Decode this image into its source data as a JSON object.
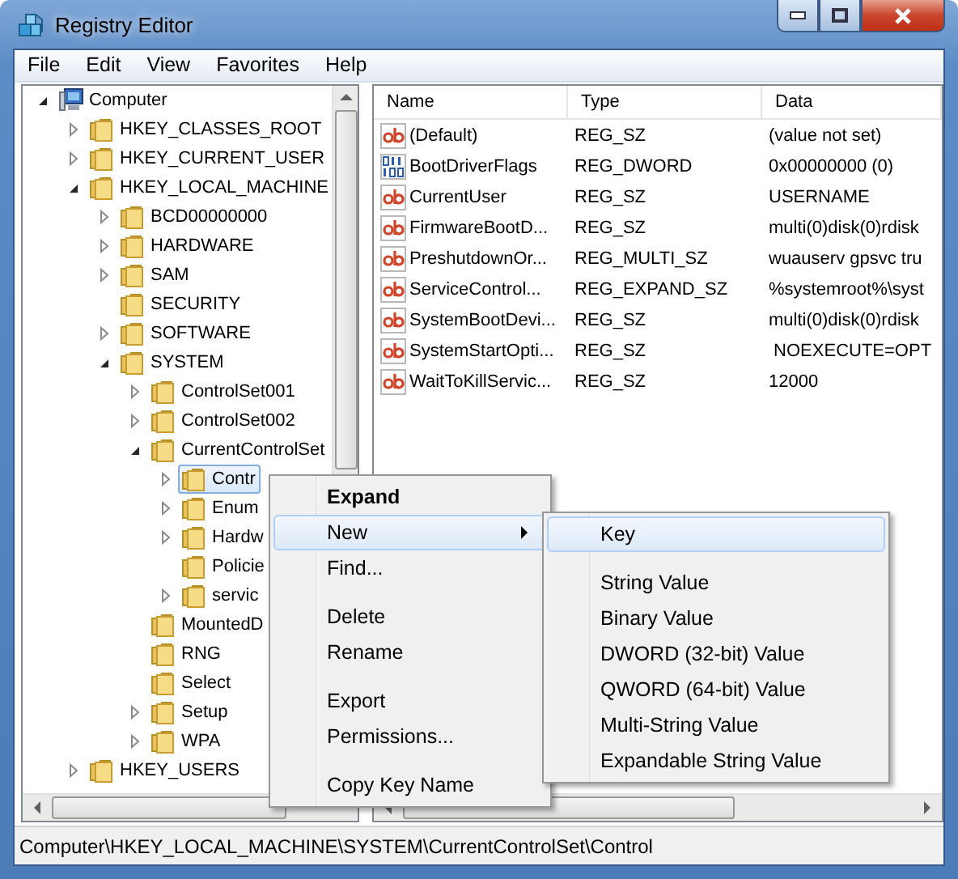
{
  "window": {
    "title": "Registry Editor"
  },
  "menu_bar": [
    "File",
    "Edit",
    "View",
    "Favorites",
    "Help"
  ],
  "tree": [
    {
      "label": "Computer",
      "kind": "computer",
      "expander": true,
      "expanded": true,
      "selected": false,
      "children": [
        {
          "label": "HKEY_CLASSES_ROOT",
          "kind": "folder",
          "expander": true,
          "expanded": false,
          "selected": false
        },
        {
          "label": "HKEY_CURRENT_USER",
          "kind": "folder",
          "expander": true,
          "expanded": false,
          "selected": false
        },
        {
          "label": "HKEY_LOCAL_MACHINE",
          "kind": "folder",
          "expander": true,
          "expanded": true,
          "selected": false,
          "children": [
            {
              "label": "BCD00000000",
              "kind": "folder",
              "expander": true,
              "expanded": false,
              "selected": false
            },
            {
              "label": "HARDWARE",
              "kind": "folder",
              "expander": true,
              "expanded": false,
              "selected": false
            },
            {
              "label": "SAM",
              "kind": "folder",
              "expander": true,
              "expanded": false,
              "selected": false
            },
            {
              "label": "SECURITY",
              "kind": "folder",
              "expander": false,
              "expanded": false,
              "selected": false
            },
            {
              "label": "SOFTWARE",
              "kind": "folder",
              "expander": true,
              "expanded": false,
              "selected": false
            },
            {
              "label": "SYSTEM",
              "kind": "folder",
              "expander": true,
              "expanded": true,
              "selected": false,
              "children": [
                {
                  "label": "ControlSet001",
                  "kind": "folder",
                  "expander": true,
                  "expanded": false,
                  "selected": false
                },
                {
                  "label": "ControlSet002",
                  "kind": "folder",
                  "expander": true,
                  "expanded": false,
                  "selected": false
                },
                {
                  "label": "CurrentControlSet",
                  "kind": "folder",
                  "expander": true,
                  "expanded": true,
                  "selected": false,
                  "children": [
                    {
                      "label": "Contr",
                      "kind": "folder",
                      "expander": true,
                      "expanded": false,
                      "selected": true
                    },
                    {
                      "label": "Enum",
                      "kind": "folder",
                      "expander": true,
                      "expanded": false,
                      "selected": false
                    },
                    {
                      "label": "Hardw",
                      "kind": "folder",
                      "expander": true,
                      "expanded": false,
                      "selected": false
                    },
                    {
                      "label": "Policie",
                      "kind": "folder",
                      "expander": false,
                      "expanded": false,
                      "selected": false
                    },
                    {
                      "label": "servic",
                      "kind": "folder",
                      "expander": true,
                      "expanded": false,
                      "selected": false
                    }
                  ]
                },
                {
                  "label": "MountedD",
                  "kind": "folder",
                  "expander": false,
                  "expanded": false,
                  "selected": false
                },
                {
                  "label": "RNG",
                  "kind": "folder",
                  "expander": false,
                  "expanded": false,
                  "selected": false
                },
                {
                  "label": "Select",
                  "kind": "folder",
                  "expander": false,
                  "expanded": false,
                  "selected": false
                },
                {
                  "label": "Setup",
                  "kind": "folder",
                  "expander": true,
                  "expanded": false,
                  "selected": false
                },
                {
                  "label": "WPA",
                  "kind": "folder",
                  "expander": true,
                  "expanded": false,
                  "selected": false
                }
              ]
            }
          ]
        },
        {
          "label": "HKEY_USERS",
          "kind": "folder",
          "expander": true,
          "expanded": false,
          "selected": false
        }
      ]
    }
  ],
  "values": {
    "columns": [
      "Name",
      "Type",
      "Data"
    ],
    "rows": [
      {
        "kind": "string",
        "name": "(Default)",
        "type": "REG_SZ",
        "data": "(value not set)"
      },
      {
        "kind": "binary",
        "name": "BootDriverFlags",
        "type": "REG_DWORD",
        "data": "0x00000000 (0)"
      },
      {
        "kind": "string",
        "name": "CurrentUser",
        "type": "REG_SZ",
        "data": "USERNAME"
      },
      {
        "kind": "string",
        "name": "FirmwareBootD...",
        "type": "REG_SZ",
        "data": "multi(0)disk(0)rdisk"
      },
      {
        "kind": "string",
        "name": "PreshutdownOr...",
        "type": "REG_MULTI_SZ",
        "data": "wuauserv gpsvc tru"
      },
      {
        "kind": "string",
        "name": "ServiceControl...",
        "type": "REG_EXPAND_SZ",
        "data": "%systemroot%\\syst"
      },
      {
        "kind": "string",
        "name": "SystemBootDevi...",
        "type": "REG_SZ",
        "data": "multi(0)disk(0)rdisk"
      },
      {
        "kind": "string",
        "name": "SystemStartOpti...",
        "type": "REG_SZ",
        "data": " NOEXECUTE=OPT"
      },
      {
        "kind": "string",
        "name": "WaitToKillServic...",
        "type": "REG_SZ",
        "data": "12000"
      }
    ]
  },
  "context_menu": {
    "items": [
      {
        "kind": "item",
        "label": "Expand",
        "bold": true,
        "selected": false,
        "has_submenu": false
      },
      {
        "kind": "item",
        "label": "New",
        "bold": false,
        "selected": true,
        "has_submenu": true
      },
      {
        "kind": "item",
        "label": "Find...",
        "bold": false,
        "selected": false,
        "has_submenu": false
      },
      {
        "kind": "separator"
      },
      {
        "kind": "item",
        "label": "Delete",
        "bold": false,
        "selected": false,
        "has_submenu": false
      },
      {
        "kind": "item",
        "label": "Rename",
        "bold": false,
        "selected": false,
        "has_submenu": false
      },
      {
        "kind": "separator"
      },
      {
        "kind": "item",
        "label": "Export",
        "bold": false,
        "selected": false,
        "has_submenu": false
      },
      {
        "kind": "item",
        "label": "Permissions...",
        "bold": false,
        "selected": false,
        "has_submenu": false
      },
      {
        "kind": "separator"
      },
      {
        "kind": "item",
        "label": "Copy Key Name",
        "bold": false,
        "selected": false,
        "has_submenu": false
      }
    ]
  },
  "submenu": {
    "items": [
      {
        "kind": "item",
        "label": "Key",
        "bold": false,
        "selected": true,
        "has_submenu": false
      },
      {
        "kind": "separator"
      },
      {
        "kind": "item",
        "label": "String Value",
        "bold": false,
        "selected": false,
        "has_submenu": false
      },
      {
        "kind": "item",
        "label": "Binary Value",
        "bold": false,
        "selected": false,
        "has_submenu": false
      },
      {
        "kind": "item",
        "label": "DWORD (32-bit) Value",
        "bold": false,
        "selected": false,
        "has_submenu": false
      },
      {
        "kind": "item",
        "label": "QWORD (64-bit) Value",
        "bold": false,
        "selected": false,
        "has_submenu": false
      },
      {
        "kind": "item",
        "label": "Multi-String Value",
        "bold": false,
        "selected": false,
        "has_submenu": false
      },
      {
        "kind": "item",
        "label": "Expandable String Value",
        "bold": false,
        "selected": false,
        "has_submenu": false
      }
    ]
  },
  "status_bar": "Computer\\HKEY_LOCAL_MACHINE\\SYSTEM\\CurrentControlSet\\Control"
}
